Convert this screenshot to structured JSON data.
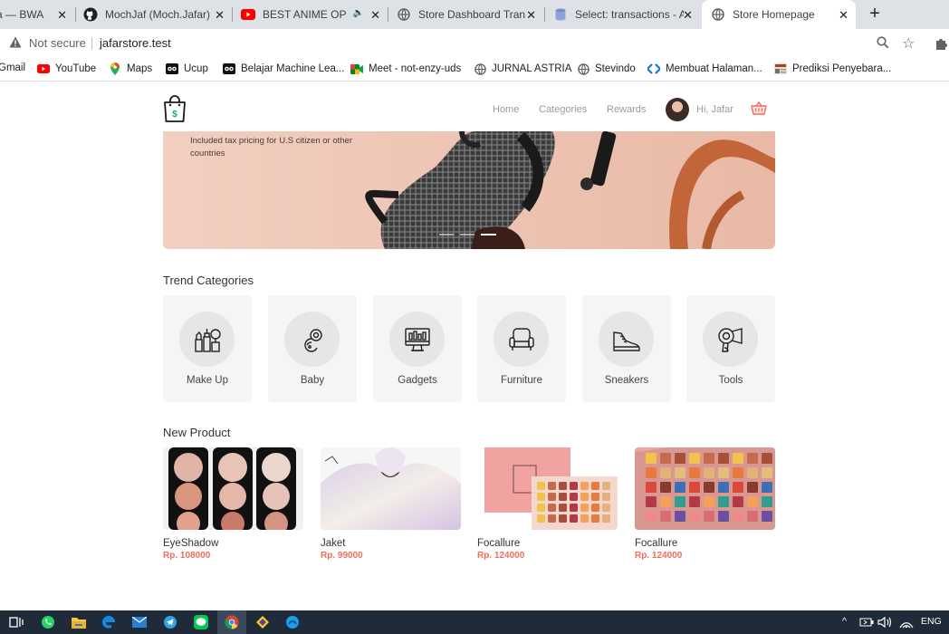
{
  "browser": {
    "tabs": [
      {
        "title": "a — BWA",
        "icon": "tab-generic-icon"
      },
      {
        "title": "MochJaf (Moch.Jafar)",
        "icon": "github-icon"
      },
      {
        "title": "BEST ANIME OPENI",
        "icon": "youtube-icon"
      },
      {
        "title": "Store Dashboard Transa",
        "icon": "globe-icon"
      },
      {
        "title": "Select: transactions - Ac",
        "icon": "database-icon"
      },
      {
        "title": "Store Homepage",
        "icon": "globe-icon"
      }
    ],
    "address": {
      "security": "Not secure",
      "url": "jafarstore.test"
    },
    "bookmarks": [
      {
        "label": "Gmail"
      },
      {
        "label": "YouTube"
      },
      {
        "label": "Maps"
      },
      {
        "label": "Ucup"
      },
      {
        "label": "Belajar Machine Lea..."
      },
      {
        "label": "Meet - not-enzy-uds"
      },
      {
        "label": "JURNAL ASTRIA"
      },
      {
        "label": "Stevindo"
      },
      {
        "label": "Membuat Halaman..."
      },
      {
        "label": "Prediksi Penyebara..."
      }
    ]
  },
  "navbar": {
    "links": [
      "Home",
      "Categories",
      "Rewards"
    ],
    "greeting": "Hi, Jafar"
  },
  "banner": {
    "text": "Included tax pricing for U.S citizen or other countries"
  },
  "trend": {
    "title": "Trend Categories",
    "categories": [
      {
        "label": "Make Up",
        "icon": "makeup-icon"
      },
      {
        "label": "Baby",
        "icon": "pacifier-icon"
      },
      {
        "label": "Gadgets",
        "icon": "monitor-icon"
      },
      {
        "label": "Furniture",
        "icon": "armchair-icon"
      },
      {
        "label": "Sneakers",
        "icon": "sneaker-icon"
      },
      {
        "label": "Tools",
        "icon": "hairdryer-icon"
      }
    ]
  },
  "products": {
    "title": "New Product",
    "items": [
      {
        "name": "EyeShadow",
        "price": "Rp. 108000"
      },
      {
        "name": "Jaket",
        "price": "Rp. 99000"
      },
      {
        "name": "Focallure",
        "price": "Rp. 124000"
      },
      {
        "name": "Focallure",
        "price": "Rp. 124000"
      }
    ]
  },
  "taskbar": {
    "language": "ENG"
  },
  "colors": {
    "accent": "#f26b5b",
    "muted_text": "#9a9a9a",
    "card_bg": "#f5f5f5",
    "chrome_bg": "#dee1e6",
    "taskbar_bg": "#1f2b38"
  }
}
